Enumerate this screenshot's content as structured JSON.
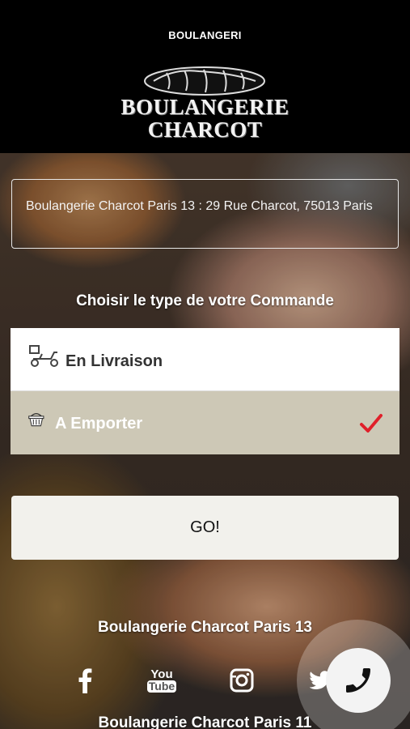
{
  "header": {
    "title": "BOULANGERI",
    "logo_text_line1": "BOULANGERIE",
    "logo_text_line2": "CHARCOT"
  },
  "address": {
    "text": "Boulangerie Charcot Paris 13 : 29 Rue Charcot, 75013 Paris"
  },
  "order_type": {
    "title": "Choisir le type de votre Commande",
    "options": [
      {
        "label": "En Livraison",
        "icon": "scooter-icon",
        "selected": false
      },
      {
        "label": "A Emporter",
        "icon": "basket-icon",
        "selected": true
      }
    ]
  },
  "go_button": {
    "label": "GO!"
  },
  "footer": {
    "store_1": "Boulangerie Charcot Paris 13",
    "store_2": "Boulangerie Charcot Paris 11",
    "social_icons": [
      "facebook-icon",
      "youtube-icon",
      "instagram-icon",
      "twitter-icon"
    ],
    "youtube_text_1": "You",
    "youtube_text_2": "Tube"
  },
  "colors": {
    "selected_background": "#cdc8b6",
    "checkmark": "#e0202a",
    "header_background": "#000000"
  }
}
